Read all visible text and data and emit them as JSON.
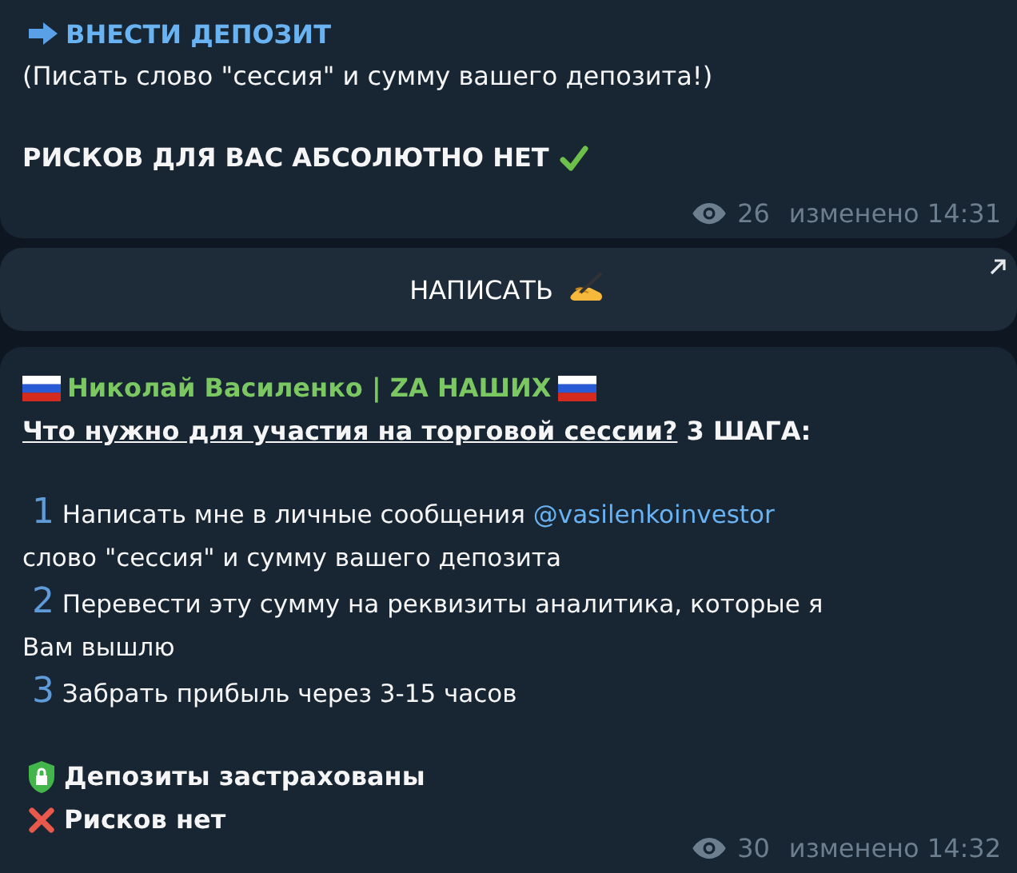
{
  "post_1": {
    "heading": "ВНЕСТИ ДЕПОЗИТ",
    "note": "(Писать слово \"сессия\" и сумму вашего депозита!)",
    "slogan": "РИСКОВ ДЛЯ ВАС АБСОЛЮТНО НЕТ",
    "views": "26",
    "edited": "изменено 14:31"
  },
  "inline_button": {
    "label": "НАПИСАТЬ"
  },
  "post_2": {
    "author": "Николай Василенко | ZA НАШИХ",
    "question": "Что нужно для участия на торговой сессии?",
    "question_suffix": "3 ШАГА:",
    "steps": [
      {
        "number": "1",
        "text": "Написать мне в личные сообщения",
        "mention": "@vasilenkoinvestor",
        "continuation": "слово \"сессия\" и сумму вашего депозита"
      },
      {
        "number": "2",
        "text": "Перевести эту сумму на реквизиты аналитика, которые я",
        "continuation": "Вам вышлю"
      },
      {
        "number": "3",
        "text": "Забрать прибыль через 3-15 часов"
      }
    ],
    "features": [
      {
        "kind": "shield",
        "text": "Депозиты застрахованы"
      },
      {
        "kind": "cross",
        "text": "Рисков нет"
      }
    ],
    "views": "30",
    "edited": "изменено 14:32"
  }
}
